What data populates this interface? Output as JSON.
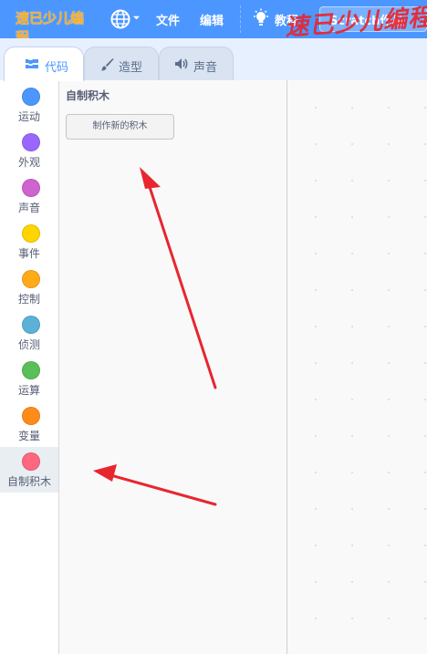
{
  "menubar": {
    "logo_text": "速已少儿编程",
    "file_label": "文件",
    "edit_label": "编辑",
    "tutorials_label": "教程",
    "project_title": "Scratch作品",
    "watermark_text": "速已少儿编程"
  },
  "tabs": {
    "code": "代码",
    "costumes": "造型",
    "sounds": "声音"
  },
  "categories": [
    {
      "label": "运动",
      "color": "#4c97ff"
    },
    {
      "label": "外观",
      "color": "#9966ff"
    },
    {
      "label": "声音",
      "color": "#cf63cf"
    },
    {
      "label": "事件",
      "color": "#ffd500"
    },
    {
      "label": "控制",
      "color": "#ffab19"
    },
    {
      "label": "侦测",
      "color": "#5cb1d6"
    },
    {
      "label": "运算",
      "color": "#59c059"
    },
    {
      "label": "变量",
      "color": "#ff8c1a"
    },
    {
      "label": "自制积木",
      "color": "#ff6680"
    }
  ],
  "palette": {
    "section_title": "自制积木",
    "make_block_button": "制作新的积木"
  },
  "colors": {
    "menubar": "#4c97ff",
    "annotation_arrow": "#e8262e"
  }
}
